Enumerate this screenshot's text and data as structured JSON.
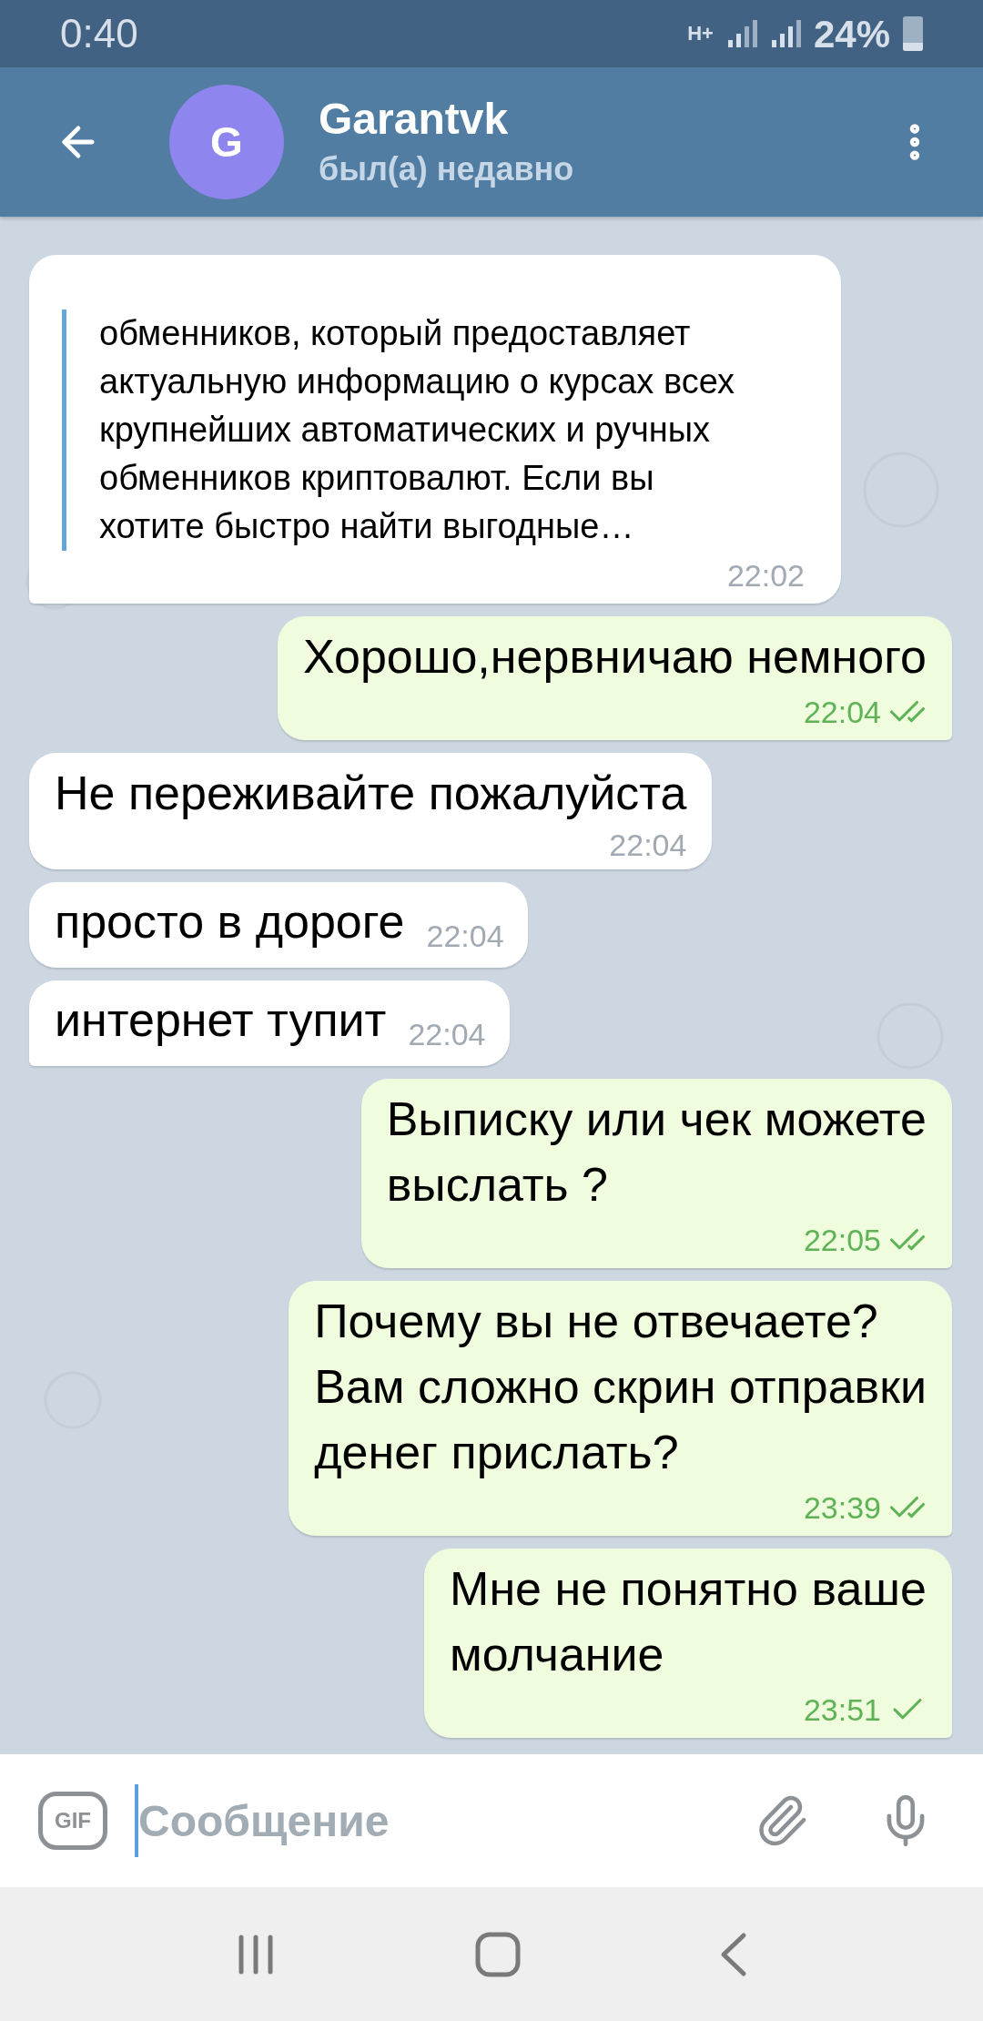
{
  "status_bar": {
    "time": "0:40",
    "network": "H+",
    "battery": "24%"
  },
  "header": {
    "avatar_letter": "G",
    "name": "Garantvk",
    "status": "был(а) недавно"
  },
  "messages": [
    {
      "outgoing": false,
      "kind": "quote",
      "lines": [
        "обменников, который предоставляет",
        "актуальную информацию о курсах всех",
        "крупнейших автоматических и ручных",
        "обменников криптовалют. Если вы",
        "хотите быстро найти выгодные…"
      ],
      "time": "22:02",
      "tail": true
    },
    {
      "outgoing": true,
      "kind": "standard",
      "lines": [
        "Хорошо,нервничаю немного"
      ],
      "time": "22:04",
      "read": true,
      "tail": true
    },
    {
      "outgoing": false,
      "kind": "standard",
      "lines": [
        "Не переживайте пожалуйста"
      ],
      "time": "22:04",
      "tail": false
    },
    {
      "outgoing": false,
      "kind": "compact",
      "lines": [
        "просто в дороге"
      ],
      "time": "22:04",
      "tail": false
    },
    {
      "outgoing": false,
      "kind": "compact",
      "lines": [
        "интернет тупит"
      ],
      "time": "22:04",
      "tail": true
    },
    {
      "outgoing": true,
      "kind": "standard",
      "lines": [
        "Выписку или чек можете",
        "выслать ?"
      ],
      "time": "22:05",
      "read": true,
      "tail": true
    },
    {
      "outgoing": true,
      "kind": "standard",
      "lines": [
        "Почему вы не отвечаете?",
        "Вам сложно скрин отправки",
        "денег прислать?"
      ],
      "time": "23:39",
      "read": true,
      "tail": true
    },
    {
      "outgoing": true,
      "kind": "standard",
      "lines": [
        "Мне не понятно ваше",
        "молчание"
      ],
      "time": "23:51",
      "read": false,
      "tail": true
    }
  ],
  "composer": {
    "gif_label": "GIF",
    "placeholder": "Сообщение"
  }
}
